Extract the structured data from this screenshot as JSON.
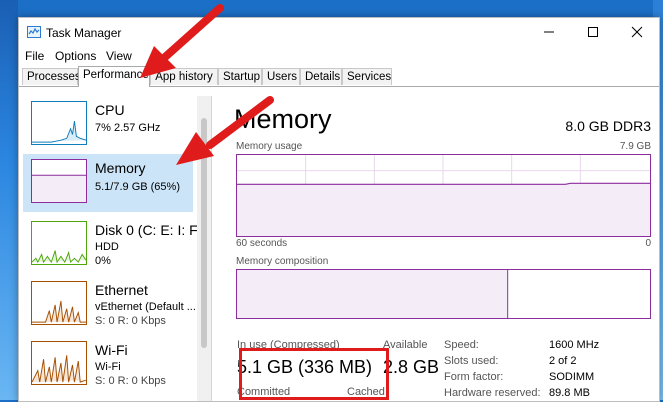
{
  "window": {
    "title": "Task Manager"
  },
  "menu": [
    "File",
    "Options",
    "View"
  ],
  "tabs": [
    "Processes",
    "Performance",
    "App history",
    "Startup",
    "Users",
    "Details",
    "Services"
  ],
  "sidebar": {
    "items": [
      {
        "title": "CPU",
        "sub1": "7% 2.57 GHz",
        "sub2": ""
      },
      {
        "title": "Memory",
        "sub1": "5.1/7.9 GB (65%)",
        "sub2": ""
      },
      {
        "title": "Disk 0 (C: E: I: F:",
        "sub1": "HDD",
        "sub2": "0%"
      },
      {
        "title": "Ethernet",
        "sub1": "vEthernet (Default ...",
        "sub2": "S: 0 R: 0 Kbps"
      },
      {
        "title": "Wi-Fi",
        "sub1": "Wi-Fi",
        "sub2": "S: 0 R: 0 Kbps"
      }
    ]
  },
  "main": {
    "title": "Memory",
    "spec": "8.0 GB DDR3",
    "usage_label": "Memory usage",
    "usage_max": "7.9 GB",
    "time_label": "60 seconds",
    "time_right": "0",
    "composition_label": "Memory composition",
    "in_use_label": "In use (Compressed)",
    "in_use_value": "5.1 GB (336 MB)",
    "available_label": "Available",
    "available_value": "2.8 GB",
    "committed_label": "Committed",
    "cached_label": "Cached",
    "specs": [
      {
        "key": "Speed:",
        "value": "1600 MHz"
      },
      {
        "key": "Slots used:",
        "value": "2 of 2"
      },
      {
        "key": "Form factor:",
        "value": "SODIMM"
      },
      {
        "key": "Hardware reserved:",
        "value": "89.8 MB"
      }
    ]
  },
  "colors": {
    "memory_accent": "#8b2d9e",
    "cpu_accent": "#117dbb",
    "disk_accent": "#4da60c",
    "net_accent": "#a74f01",
    "annotation": "#e01b1b"
  }
}
